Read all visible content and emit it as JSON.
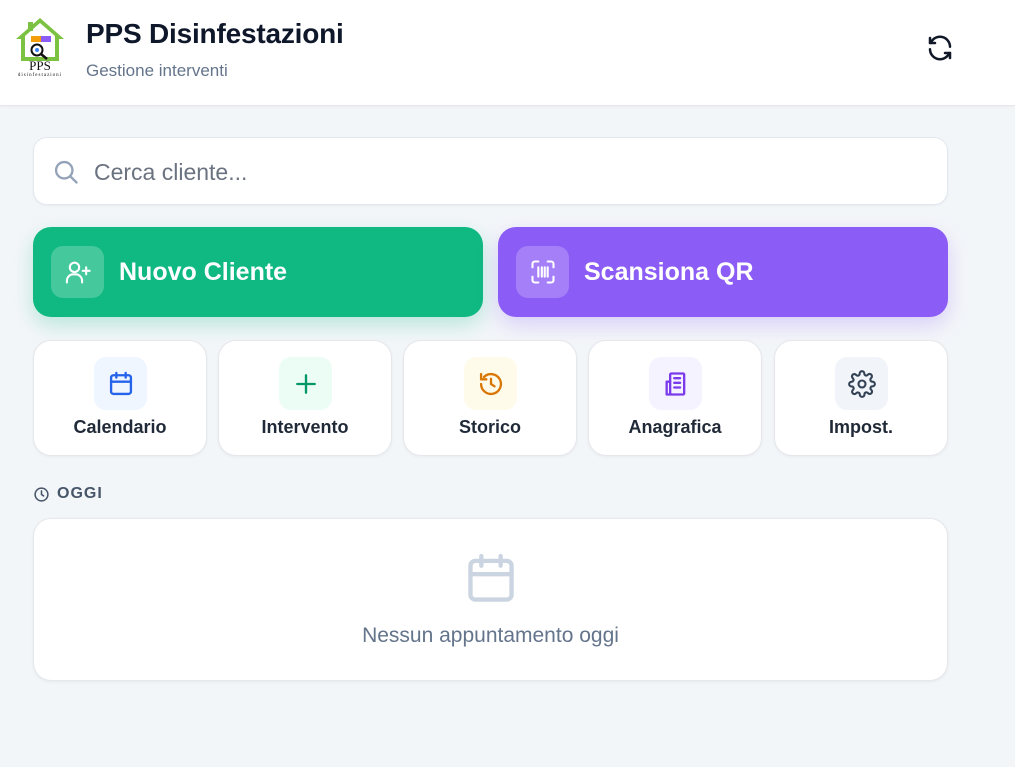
{
  "header": {
    "logo_icon": "house-bug-logo",
    "logo_text": "PPS",
    "logo_subtext": "disinfestazioni",
    "title": "PPS Disinfestazioni",
    "subtitle": "Gestione interventi",
    "refresh_icon": "refresh-icon"
  },
  "search": {
    "placeholder": "Cerca cliente...",
    "value": "",
    "icon": "search-icon"
  },
  "primary_actions": [
    {
      "label": "Nuovo Cliente",
      "icon": "user-plus-icon",
      "color": "#10b981"
    },
    {
      "label": "Scansiona QR",
      "icon": "qr-scan-icon",
      "color": "#8b5cf6"
    }
  ],
  "quick_actions": [
    {
      "label": "Calendario",
      "icon": "calendar-icon",
      "color": "#2563eb",
      "bg": "#eff6ff"
    },
    {
      "label": "Intervento",
      "icon": "plus-icon",
      "color": "#059669",
      "bg": "#ecfdf5"
    },
    {
      "label": "Storico",
      "icon": "history-icon",
      "color": "#d97706",
      "bg": "#fffbeb"
    },
    {
      "label": "Anagrafica",
      "icon": "building-icon",
      "color": "#7c3aed",
      "bg": "#f5f3ff"
    },
    {
      "label": "Impost.",
      "icon": "gear-icon",
      "color": "#334155",
      "bg": "#f1f5f9"
    }
  ],
  "today": {
    "section_label": "OGGI",
    "section_icon": "clock-icon",
    "empty_icon": "calendar-icon",
    "empty_text": "Nessun appuntamento oggi"
  }
}
